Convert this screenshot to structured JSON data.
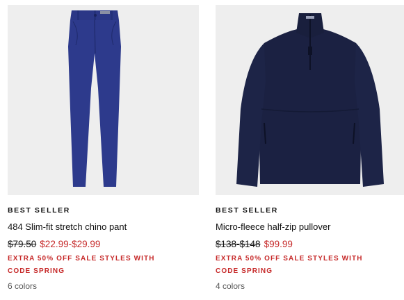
{
  "products": [
    {
      "image_alt": "pants",
      "badge": "BEST SELLER",
      "title": "484 Slim-fit stretch chino pant",
      "price_original": "$79.50",
      "price_sale": "$22.99-$29.99",
      "promo": "EXTRA 50% OFF SALE STYLES WITH CODE SPRING",
      "colors": "6 colors",
      "image_color": "#2d3a8c"
    },
    {
      "image_alt": "pullover",
      "badge": "BEST SELLER",
      "title": "Micro-fleece half-zip pullover",
      "price_original": "$138-$148",
      "price_sale": "$99.99",
      "promo": "EXTRA 50% OFF SALE STYLES WITH CODE SPRING",
      "colors": "4 colors",
      "image_color": "#1b2142"
    }
  ]
}
